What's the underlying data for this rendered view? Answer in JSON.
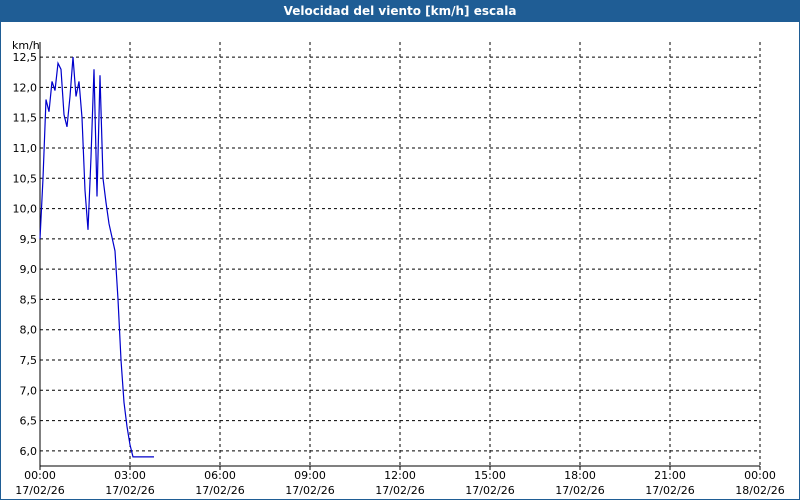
{
  "window": {
    "title": "Velocidad del viento [km/h] escala"
  },
  "chart_data": {
    "type": "line",
    "title": "Velocidad del viento [km/h] escala",
    "ylabel": "km/h",
    "ylim": [
      5.75,
      12.75
    ],
    "yticks": [
      "12,5",
      "12,0",
      "11,5",
      "11,0",
      "10,5",
      "10,0",
      "9,5",
      "9,0",
      "8,5",
      "8,0",
      "7,5",
      "7,0",
      "6,5",
      "6,0"
    ],
    "ytick_values": [
      12.5,
      12.0,
      11.5,
      11.0,
      10.5,
      10.0,
      9.5,
      9.0,
      8.5,
      8.0,
      7.5,
      7.0,
      6.5,
      6.0
    ],
    "xlim_hours": [
      0,
      24
    ],
    "xticks": [
      {
        "hour": 0,
        "time": "00:00",
        "date": "17/02/26"
      },
      {
        "hour": 3,
        "time": "03:00",
        "date": "17/02/26"
      },
      {
        "hour": 6,
        "time": "06:00",
        "date": "17/02/26"
      },
      {
        "hour": 9,
        "time": "09:00",
        "date": "17/02/26"
      },
      {
        "hour": 12,
        "time": "12:00",
        "date": "17/02/26"
      },
      {
        "hour": 15,
        "time": "15:00",
        "date": "17/02/26"
      },
      {
        "hour": 18,
        "time": "18:00",
        "date": "17/02/26"
      },
      {
        "hour": 21,
        "time": "21:00",
        "date": "17/02/26"
      },
      {
        "hour": 24,
        "time": "00:00",
        "date": "18/02/26"
      }
    ],
    "grid": true,
    "series": [
      {
        "color": "#0000cc",
        "x": [
          0.0,
          0.1,
          0.2,
          0.3,
          0.4,
          0.5,
          0.6,
          0.7,
          0.8,
          0.9,
          1.0,
          1.1,
          1.2,
          1.3,
          1.4,
          1.5,
          1.6,
          1.7,
          1.8,
          1.9,
          2.0,
          2.1,
          2.2,
          2.3,
          2.5,
          2.6,
          2.7,
          2.8,
          2.9,
          3.0,
          3.1,
          3.2,
          3.3,
          3.4,
          3.5,
          3.6,
          3.7,
          3.75,
          3.8
        ],
        "y": [
          9.5,
          10.5,
          11.8,
          11.6,
          12.1,
          11.95,
          12.4,
          12.3,
          11.55,
          11.35,
          11.85,
          12.5,
          11.85,
          12.1,
          11.5,
          10.3,
          9.65,
          10.85,
          12.3,
          10.2,
          12.2,
          10.5,
          10.1,
          9.75,
          9.3,
          8.5,
          7.5,
          6.8,
          6.4,
          6.1,
          5.9,
          5.9,
          5.9,
          5.9,
          5.9,
          5.9,
          5.9,
          5.9,
          5.9
        ]
      }
    ]
  }
}
